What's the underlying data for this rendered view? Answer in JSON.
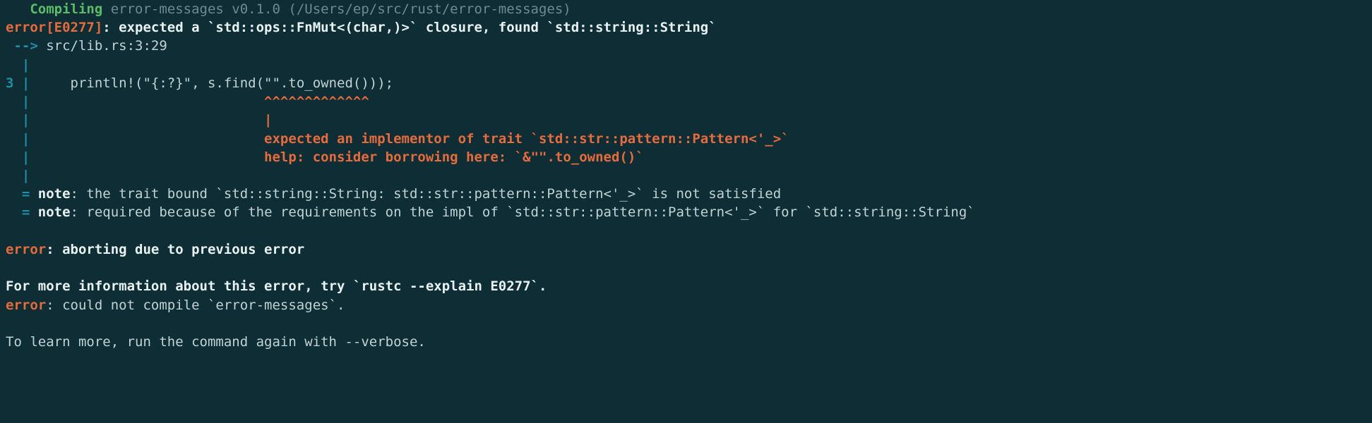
{
  "l1a": "   Compiling",
  "l1b": " error-messages v0.1.0 (/Users/ep/src/rust/error-messages)",
  "l2a": "error[E0277]",
  "l2b": ": expected a `std::ops::FnMut<(char,)>` closure, found `std::string::String`",
  "l3a": " --> ",
  "l3b": "src/lib.rs:3:29",
  "l4": "  |",
  "l5a": "3 |",
  "l5b": "     println!(\"{:?}\", s.find(\"\".to_owned()));",
  "l6a": "  |",
  "l6b": "                             ^^^^^^^^^^^^^",
  "l7a": "  |",
  "l7b": "                             |",
  "l8a": "  |",
  "l8b": "                             expected an implementor of trait `std::str::pattern::Pattern<'_>`",
  "l9a": "  |",
  "l9b": "                             help",
  "l9c": ": consider borrowing here: `",
  "l9d": "&\"\".to_owned()",
  "l9e": "`",
  "l10": "  |",
  "l11a": "  = ",
  "l11b": "note",
  "l11c": ": the trait bound `std::string::String: std::str::pattern::Pattern<'_>` is not satisfied",
  "l12a": "  = ",
  "l12b": "note",
  "l12c": ": required because of the requirements on the impl of `std::str::pattern::Pattern<'_>` for `std::string::String`",
  "blank": "",
  "l14a": "error",
  "l14b": ": aborting due to previous error",
  "l16": "For more information about this error, try `rustc --explain E0277`.",
  "l17a": "error",
  "l17b": ": could not compile `error-messages`.",
  "l19": "To learn more, run the command again with --verbose."
}
